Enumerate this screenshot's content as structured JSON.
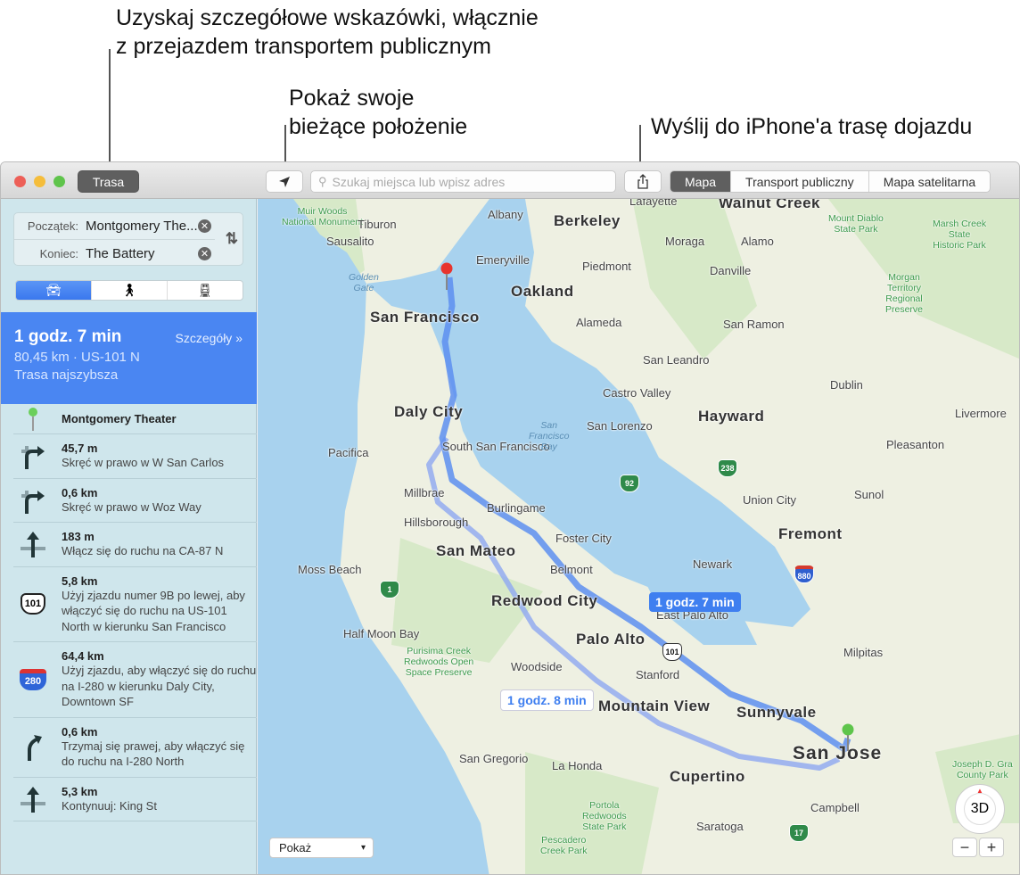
{
  "callouts": {
    "directions": [
      "Uzyskaj szczegółowe wskazówki, włącznie",
      "z przejazdem transportem publicznym"
    ],
    "location": [
      "Pokaż swoje",
      "bieżące położenie"
    ],
    "share": "Wyślij do iPhone'a trasę dojazdu"
  },
  "toolbar": {
    "directions_button": "Trasa",
    "search_placeholder": "Szukaj miejsca lub wpisz adres",
    "view_tabs": [
      {
        "label": "Mapa",
        "selected": true
      },
      {
        "label": "Transport publiczny",
        "selected": false
      },
      {
        "label": "Mapa satelitarna",
        "selected": false
      }
    ]
  },
  "sidebar": {
    "start_label": "Początek:",
    "start_value": "Montgomery The...",
    "end_label": "Koniec:",
    "end_value": "The Battery",
    "modes": [
      {
        "name": "car",
        "selected": true
      },
      {
        "name": "walk",
        "selected": false
      },
      {
        "name": "transit",
        "selected": false
      }
    ],
    "route": {
      "time": "1 godz. 7 min",
      "details_link": "Szczegóły",
      "info": "80,45 km · US-101 N",
      "note": "Trasa najszybsza"
    },
    "origin": "Montgomery Theater",
    "steps": [
      {
        "icon": "turn-right",
        "distance": "45,7 m",
        "text": "Skręć w prawo w W San Carlos"
      },
      {
        "icon": "turn-right",
        "distance": "0,6 km",
        "text": "Skręć w prawo w Woz Way"
      },
      {
        "icon": "straight",
        "distance": "183 m",
        "text": "Włącz się do ruchu na CA-87 N"
      },
      {
        "icon": "us-101-shield",
        "distance": "5,8 km",
        "text": "Użyj zjazdu numer 9B po lewej, aby włączyć się do ruchu na US-101 North w kierunku San Francisco"
      },
      {
        "icon": "i-280-shield",
        "distance": "64,4 km",
        "text": "Użyj zjazdu, aby włączyć się do ruchu na I-280 w kierunku Daly City, Downtown SF"
      },
      {
        "icon": "bear-right",
        "distance": "0,6 km",
        "text": "Trzymaj się prawej, aby włączyć się do ruchu na I-280 North"
      },
      {
        "icon": "straight",
        "distance": "5,3 km",
        "text": "Kontynuuj: King St"
      }
    ]
  },
  "map": {
    "labels": [
      {
        "text": "Muir Woods\nNational Monument",
        "kind": "park"
      },
      {
        "text": "Tiburon",
        "kind": "city"
      },
      {
        "text": "Albany",
        "kind": "city"
      },
      {
        "text": "Berkeley",
        "kind": "big"
      },
      {
        "text": "Lafayette",
        "kind": "city"
      },
      {
        "text": "Walnut Creek",
        "kind": "big"
      },
      {
        "text": "Mount Diablo\nState Park",
        "kind": "park"
      },
      {
        "text": "Marsh Creek\nState\nHistoric Park",
        "kind": "park"
      },
      {
        "text": "Sausalito",
        "kind": "city"
      },
      {
        "text": "Moraga",
        "kind": "city"
      },
      {
        "text": "Alamo",
        "kind": "city"
      },
      {
        "text": "Emeryville",
        "kind": "city"
      },
      {
        "text": "Piedmont",
        "kind": "city"
      },
      {
        "text": "Danville",
        "kind": "city"
      },
      {
        "text": "Golden\nGate",
        "kind": "water"
      },
      {
        "text": "Oakland",
        "kind": "big"
      },
      {
        "text": "Morgan\nTerritory\nRegional\nPreserve",
        "kind": "park"
      },
      {
        "text": "San Francisco",
        "kind": "big"
      },
      {
        "text": "Alameda",
        "kind": "city"
      },
      {
        "text": "San Ramon",
        "kind": "city"
      },
      {
        "text": "San Leandro",
        "kind": "city"
      },
      {
        "text": "Castro Valley",
        "kind": "city"
      },
      {
        "text": "Dublin",
        "kind": "city"
      },
      {
        "text": "Livermore",
        "kind": "city"
      },
      {
        "text": "Daly City",
        "kind": "big"
      },
      {
        "text": "Hayward",
        "kind": "big"
      },
      {
        "text": "San Lorenzo",
        "kind": "city"
      },
      {
        "text": "Pleasanton",
        "kind": "city"
      },
      {
        "text": "South San\nFrancisco",
        "kind": "city"
      },
      {
        "text": "San\nFrancisco\nBay",
        "kind": "water"
      },
      {
        "text": "Pacifica",
        "kind": "city"
      },
      {
        "text": "Millbrae",
        "kind": "city"
      },
      {
        "text": "Burlingame",
        "kind": "city"
      },
      {
        "text": "Union City",
        "kind": "city"
      },
      {
        "text": "Sunol",
        "kind": "city"
      },
      {
        "text": "Hillsborough",
        "kind": "city"
      },
      {
        "text": "Foster City",
        "kind": "city"
      },
      {
        "text": "Fremont",
        "kind": "big"
      },
      {
        "text": "San Mateo",
        "kind": "big"
      },
      {
        "text": "Belmont",
        "kind": "city"
      },
      {
        "text": "Moss Beach",
        "kind": "city"
      },
      {
        "text": "Newark",
        "kind": "city"
      },
      {
        "text": "Redwood City",
        "kind": "big"
      },
      {
        "text": "East Palo Alto",
        "kind": "city"
      },
      {
        "text": "Half Moon Bay",
        "kind": "city"
      },
      {
        "text": "Purisima Creek\nRedwoods Open\nSpace Preserve",
        "kind": "park"
      },
      {
        "text": "Palo Alto",
        "kind": "big"
      },
      {
        "text": "Milpitas",
        "kind": "city"
      },
      {
        "text": "Woodside",
        "kind": "city"
      },
      {
        "text": "Stanford",
        "kind": "city"
      },
      {
        "text": "Mountain View",
        "kind": "big"
      },
      {
        "text": "Sunnyvale",
        "kind": "big"
      },
      {
        "text": "San Jose",
        "kind": "huge"
      },
      {
        "text": "San Gregorio",
        "kind": "city"
      },
      {
        "text": "La Honda",
        "kind": "city"
      },
      {
        "text": "Cupertino",
        "kind": "big"
      },
      {
        "text": "Joseph D. Gra\nCounty Park",
        "kind": "park"
      },
      {
        "text": "Campbell",
        "kind": "city"
      },
      {
        "text": "Portola\nRedwoods\nState Park",
        "kind": "park"
      },
      {
        "text": "Saratoga",
        "kind": "city"
      },
      {
        "text": "Pescadero\nCreek Park",
        "kind": "park"
      }
    ],
    "shields": [
      "1",
      "92",
      "238",
      "880",
      "101",
      "17"
    ],
    "route_primary_label": "1 godz. 7 min",
    "route_alt_label": "1 godz. 8 min",
    "show_menu": "Pokaż",
    "compass_label": "3D",
    "zoom_out": "−",
    "zoom_in": "+",
    "colors": {
      "route": "#4a86f2",
      "water": "#a8d2ee",
      "land": "#eef0e2",
      "park": "#cfe6c0"
    }
  }
}
